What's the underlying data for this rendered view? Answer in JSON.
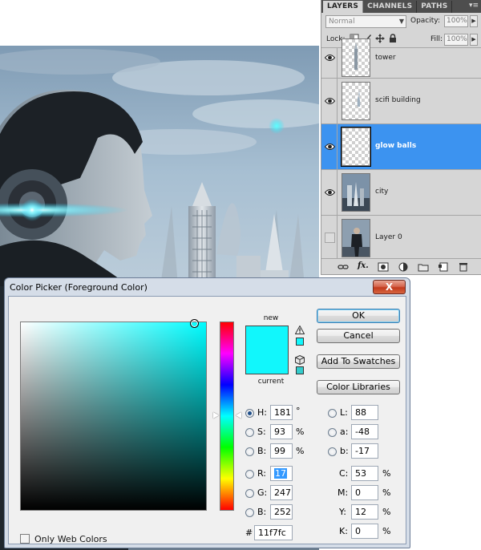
{
  "layers_panel": {
    "tabs": [
      "LAYERS",
      "CHANNELS",
      "PATHS"
    ],
    "menu_icon": "panel-menu-icon",
    "blend_mode": "Normal",
    "opacity_label": "Opacity:",
    "opacity_value": "100%",
    "lock_label": "Lock:",
    "fill_label": "Fill:",
    "fill_value": "100%",
    "layers": [
      {
        "name": "tower",
        "visible": true,
        "selected": false
      },
      {
        "name": "scifi building",
        "visible": true,
        "selected": false
      },
      {
        "name": "glow balls",
        "visible": true,
        "selected": true
      },
      {
        "name": "city",
        "visible": true,
        "selected": false
      },
      {
        "name": "Layer 0",
        "visible": false,
        "selected": false
      }
    ],
    "footer_icons": [
      "link-icon",
      "fx-icon",
      "mask-icon",
      "adjustment-icon",
      "group-folder-icon",
      "new-layer-icon",
      "trash-icon"
    ]
  },
  "color_picker": {
    "title": "Color Picker (Foreground Color)",
    "close_label": "X",
    "new_label": "new",
    "current_label": "current",
    "new_color": "#11f7fc",
    "current_color": "#11f7fc",
    "web_safe_color": "#33cccc",
    "buttons": {
      "ok": "OK",
      "cancel": "Cancel",
      "add_to_swatches": "Add To Swatches",
      "color_libraries": "Color Libraries"
    },
    "hsb": {
      "h_label": "H:",
      "h_value": "181",
      "h_unit": "°",
      "s_label": "S:",
      "s_value": "93",
      "s_unit": "%",
      "b_label": "B:",
      "b_value": "99",
      "b_unit": "%"
    },
    "rgb": {
      "r_label": "R:",
      "r_value": "17",
      "g_label": "G:",
      "g_value": "247",
      "b_label": "B:",
      "b_value": "252"
    },
    "lab": {
      "l_label": "L:",
      "l_value": "88",
      "a_label": "a:",
      "a_value": "-48",
      "b_label": "b:",
      "b_value": "-17"
    },
    "cmyk": {
      "c_label": "C:",
      "c_value": "53",
      "c_unit": "%",
      "m_label": "M:",
      "m_value": "0",
      "m_unit": "%",
      "y_label": "Y:",
      "y_value": "12",
      "y_unit": "%",
      "k_label": "K:",
      "k_value": "0",
      "k_unit": "%"
    },
    "hex_label": "#",
    "hex_value": "11f7fc",
    "only_web_colors_label": "Only Web Colors",
    "only_web_colors_checked": false,
    "selected_mode": "H",
    "hue_fraction": 0.497
  }
}
